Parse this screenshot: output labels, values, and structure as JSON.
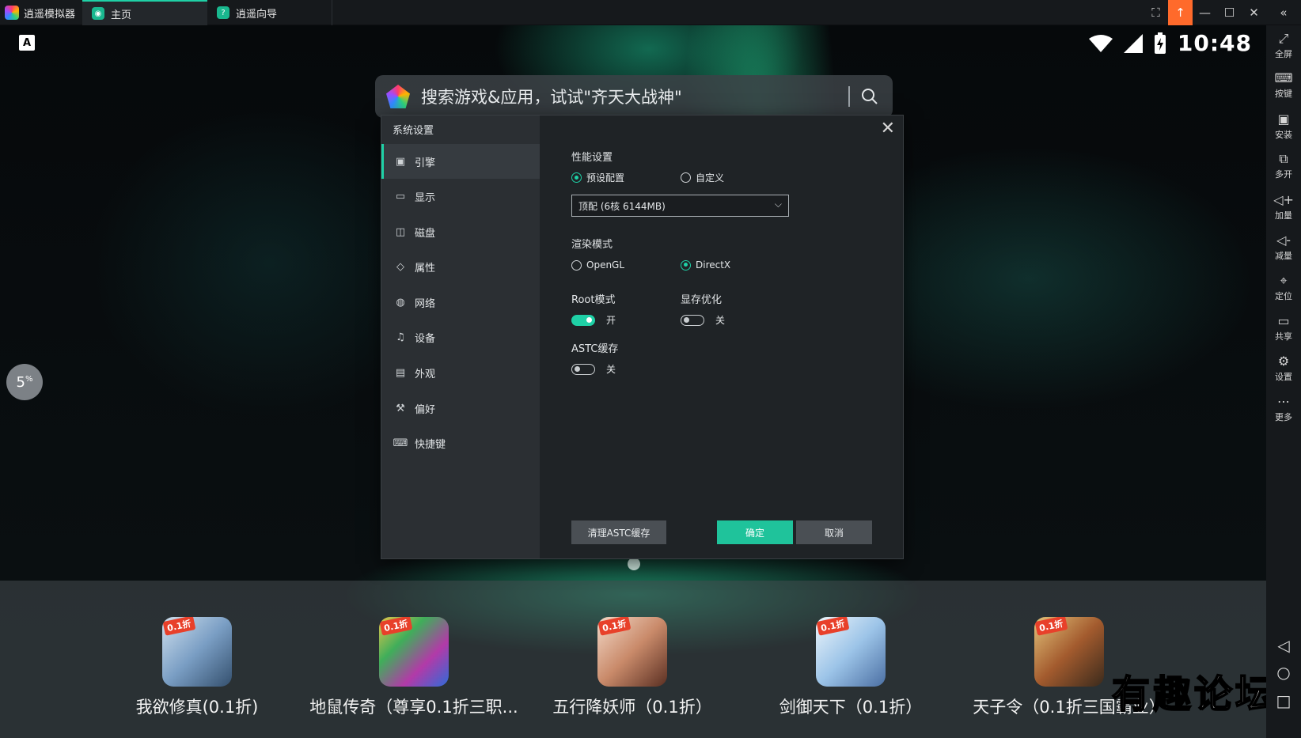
{
  "titlebar": {
    "app_name": "逍遥模拟器",
    "tabs": [
      {
        "label": "主页"
      },
      {
        "label": "逍遥向导"
      }
    ],
    "controls": {
      "expand": "⛶",
      "upload": "↑",
      "minimize": "—",
      "maximize": "☐",
      "close": "✕",
      "collapse": "«"
    }
  },
  "status": {
    "keyboard_indicator": "A",
    "time": "10:48"
  },
  "search": {
    "placeholder": "搜索游戏&应用，试试\"齐天大战神\""
  },
  "floating_ball": {
    "value": "5",
    "unit": "%"
  },
  "dialog": {
    "title": "系统设置",
    "close": "✕",
    "nav": [
      {
        "label": "引擎",
        "icon": "engine-icon"
      },
      {
        "label": "显示",
        "icon": "display-icon"
      },
      {
        "label": "磁盘",
        "icon": "disk-icon"
      },
      {
        "label": "属性",
        "icon": "tag-icon"
      },
      {
        "label": "网络",
        "icon": "globe-icon"
      },
      {
        "label": "设备",
        "icon": "mic-icon"
      },
      {
        "label": "外观",
        "icon": "window-icon"
      },
      {
        "label": "偏好",
        "icon": "wrench-icon"
      },
      {
        "label": "快捷键",
        "icon": "keyboard-icon"
      }
    ],
    "performance": {
      "label": "性能设置",
      "option_preset": "预设配置",
      "option_custom": "自定义",
      "selected": "preset",
      "preset_value": "顶配 (6核 6144MB)"
    },
    "render": {
      "label": "渲染模式",
      "option_opengl": "OpenGL",
      "option_directx": "DirectX",
      "selected": "DirectX"
    },
    "root": {
      "label": "Root模式",
      "state_text": "开",
      "on": true
    },
    "vram": {
      "label": "显存优化",
      "state_text": "关",
      "on": false
    },
    "astc": {
      "label": "ASTC缓存",
      "state_text": "关",
      "on": false
    },
    "buttons": {
      "clear": "清理ASTC缓存",
      "ok": "确定",
      "cancel": "取消"
    }
  },
  "dock_apps": [
    {
      "label": "我欲修真(0.1折)",
      "badge": "0.1折",
      "color": "#7a9ec4"
    },
    {
      "label": "地鼠传奇（尊享0.1折三职...",
      "badge": "0.1折",
      "color": "#3fae5a"
    },
    {
      "label": "五行降妖师（0.1折）",
      "badge": "0.1折",
      "color": "#c98a6a"
    },
    {
      "label": "剑御天下（0.1折）",
      "badge": "0.1折",
      "color": "#9cc4e8"
    },
    {
      "label": "天子令（0.1折三国霸业）",
      "badge": "0.1折",
      "color": "#a35b2e"
    }
  ],
  "watermark": "有趣论坛",
  "right_toolbar": [
    {
      "label": "全屏",
      "icon": "fullscreen-icon",
      "glyph": "⤢"
    },
    {
      "label": "按键",
      "icon": "keymap-icon",
      "glyph": "⌨"
    },
    {
      "label": "安装",
      "icon": "apk-icon",
      "glyph": "▣"
    },
    {
      "label": "多开",
      "icon": "multi-instance-icon",
      "glyph": "⧉"
    },
    {
      "label": "加量",
      "icon": "volume-up-icon",
      "glyph": "◁+"
    },
    {
      "label": "减量",
      "icon": "volume-down-icon",
      "glyph": "◁-"
    },
    {
      "label": "定位",
      "icon": "location-icon",
      "glyph": "⌖"
    },
    {
      "label": "共享",
      "icon": "folder-icon",
      "glyph": "▭"
    },
    {
      "label": "设置",
      "icon": "gear-icon",
      "glyph": "⚙"
    },
    {
      "label": "更多",
      "icon": "more-icon",
      "glyph": "⋯"
    }
  ],
  "nav_buttons": {
    "back": "◁",
    "home": "○",
    "recents": "□"
  }
}
